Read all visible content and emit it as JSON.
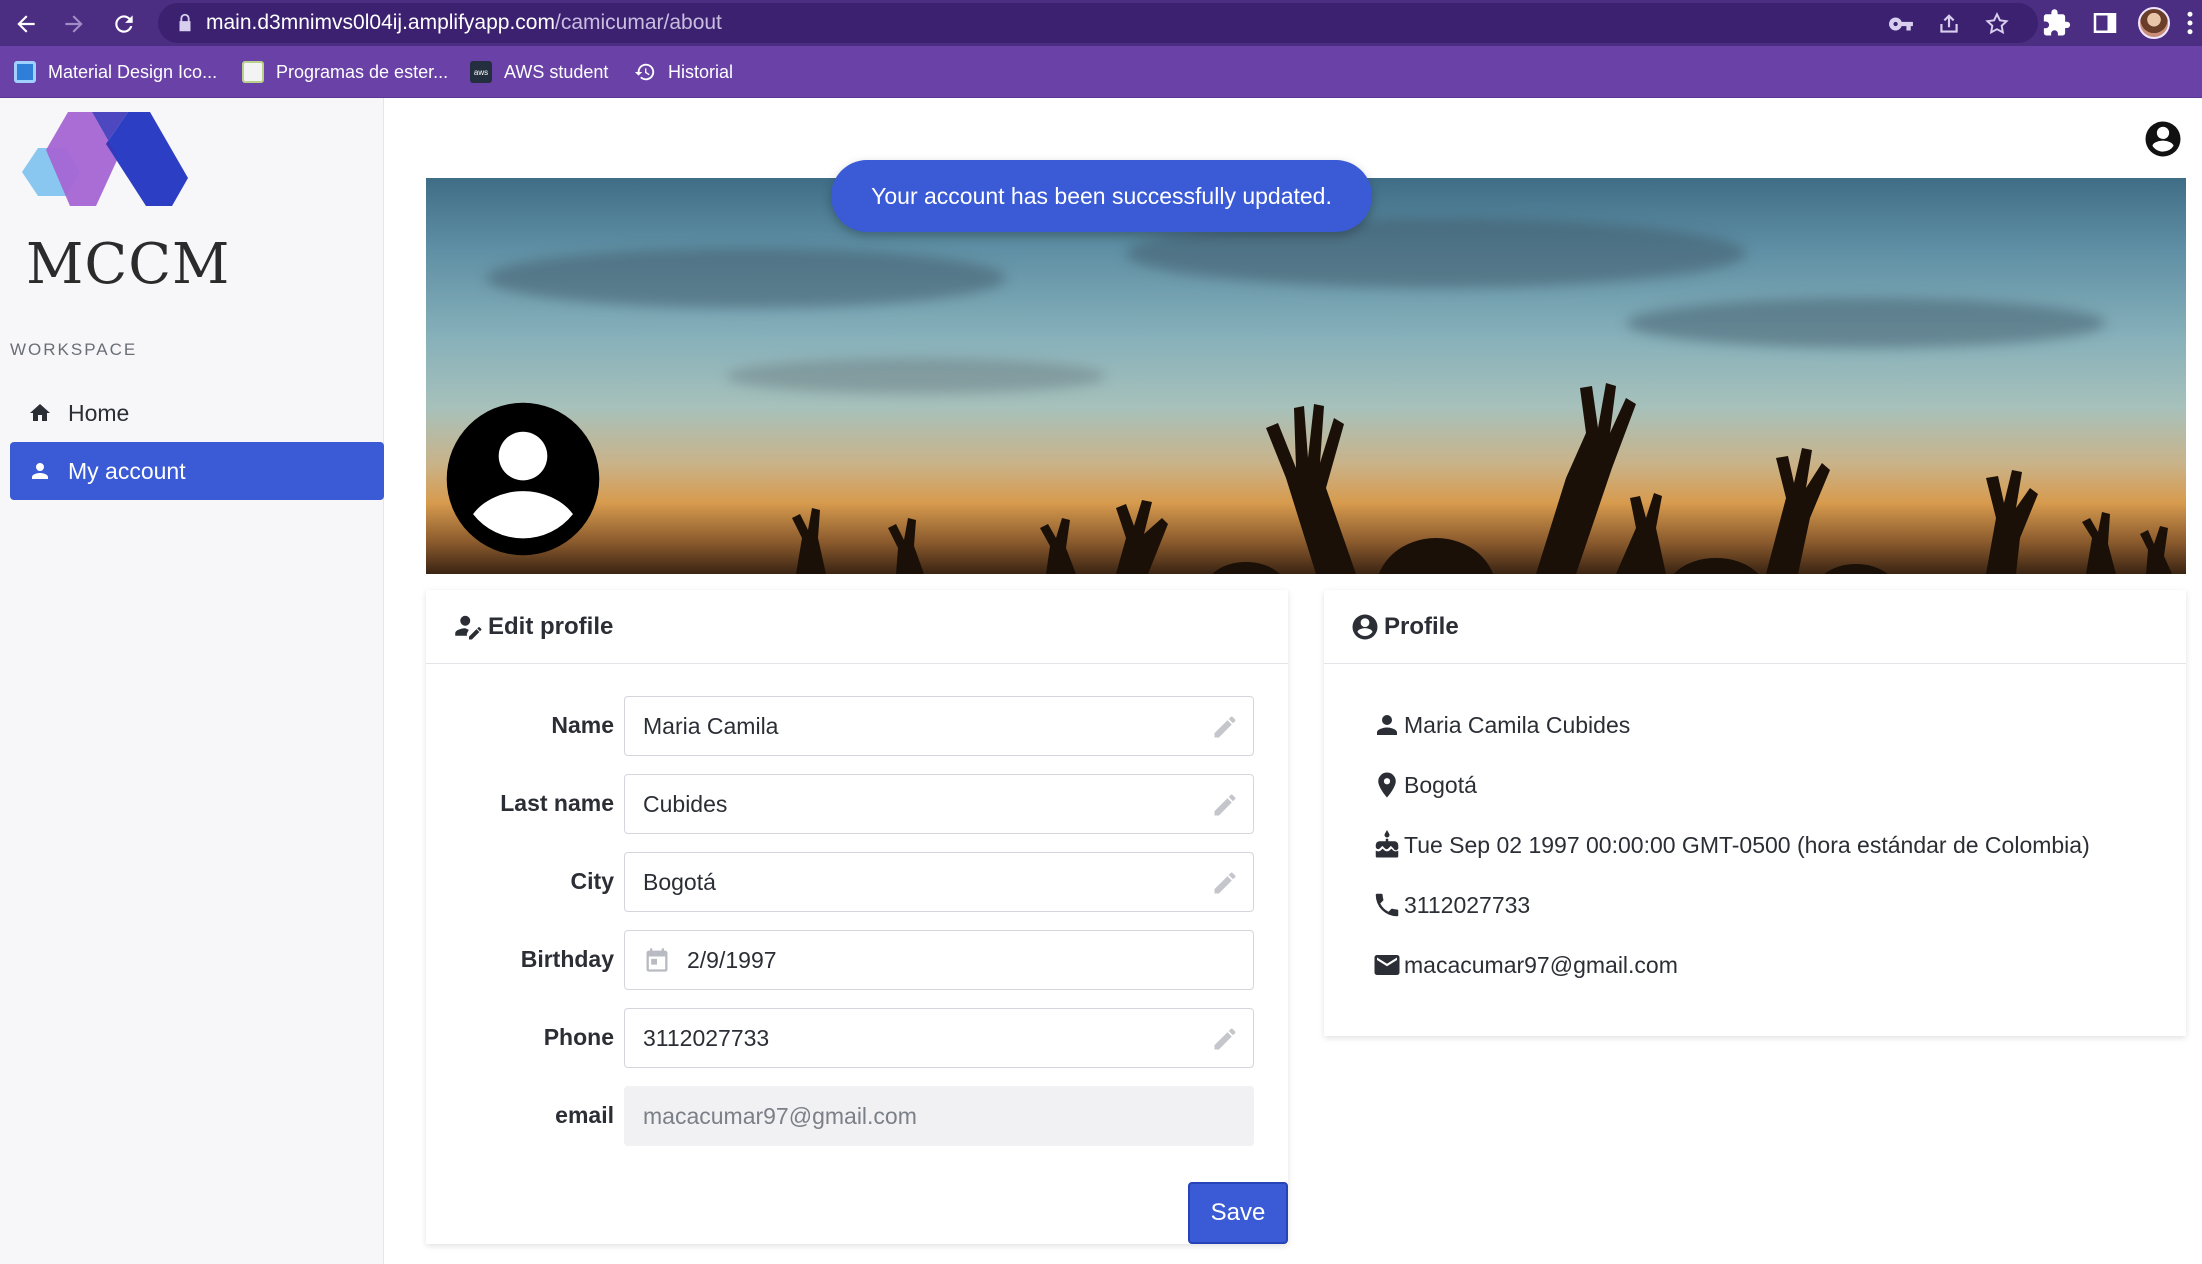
{
  "browser": {
    "url_host": "main.d3mnimvs0l04ij.amplifyapp.com",
    "url_path": "/camicumar/about",
    "bookmarks": [
      {
        "label": "Material Design Ico...",
        "icon": "material-design-icon"
      },
      {
        "label": "Programas de ester...",
        "icon": "globe-favicon"
      },
      {
        "label": "AWS student",
        "icon": "aws-icon"
      },
      {
        "label": "Historial",
        "icon": "history-icon"
      }
    ]
  },
  "sidebar": {
    "brand": "MCCM",
    "section": "WORKSPACE",
    "items": [
      {
        "label": "Home",
        "icon": "home-icon",
        "active": false
      },
      {
        "label": "My account",
        "icon": "person-icon",
        "active": true
      }
    ]
  },
  "toast": {
    "message": "Your account has been successfully updated."
  },
  "edit_profile": {
    "title": "Edit profile",
    "fields": [
      {
        "label": "Name",
        "value": "Maria Camila"
      },
      {
        "label": "Last name",
        "value": "Cubides"
      },
      {
        "label": "City",
        "value": "Bogotá"
      },
      {
        "label": "Birthday",
        "value": "2/9/1997"
      },
      {
        "label": "Phone",
        "value": "3112027733"
      },
      {
        "label": "email",
        "value": "macacumar97@gmail.com"
      }
    ],
    "save_label": "Save"
  },
  "profile": {
    "title": "Profile",
    "full_name": "Maria Camila Cubides",
    "city": "Bogotá",
    "birthday": "Tue Sep 02 1997 00:00:00 GMT-0500 (hora estándar de Colombia)",
    "phone": "3112027733",
    "email": "macacumar97@gmail.com"
  },
  "colors": {
    "accent": "#3a5ad6",
    "browser_toolbar": "#4b2d82",
    "bookmarks_bar": "#6a42a7"
  }
}
